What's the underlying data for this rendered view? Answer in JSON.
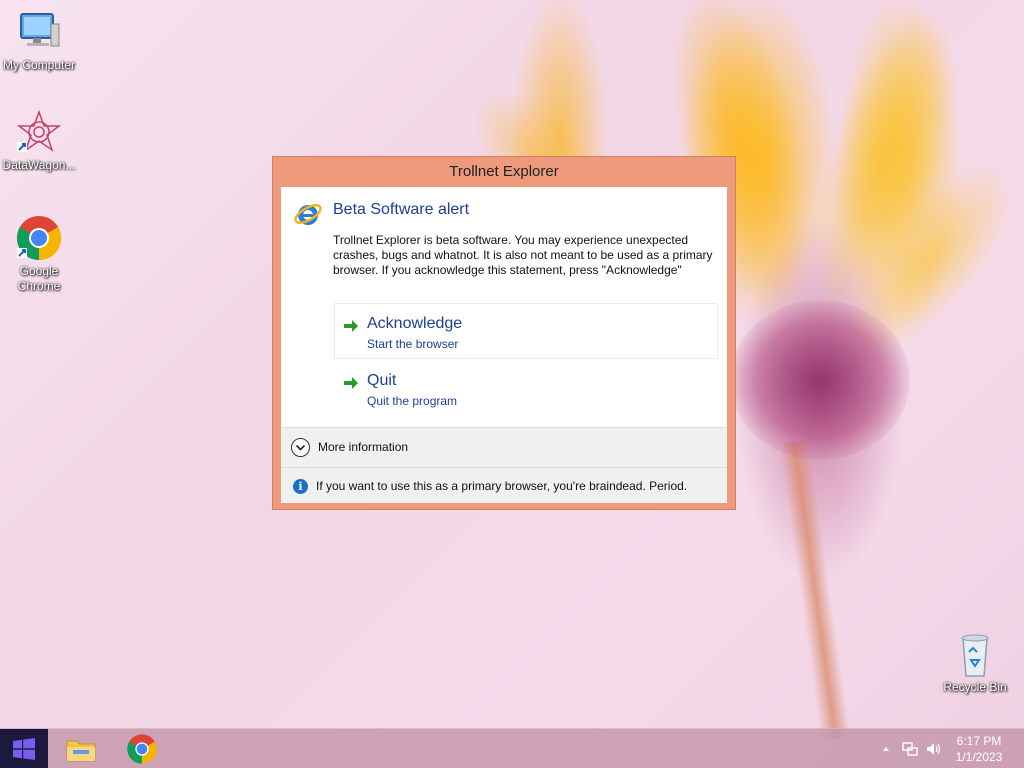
{
  "desktop": {
    "icons": [
      {
        "label": "My Computer",
        "icon": "computer-icon"
      },
      {
        "label": "DataWagon...",
        "icon": "datawagon-icon"
      },
      {
        "label": "Google Chrome",
        "icon": "chrome-icon"
      },
      {
        "label": "Recycle Bin",
        "icon": "recycle-bin-icon"
      }
    ]
  },
  "dialog": {
    "window_title": "Trollnet Explorer",
    "heading": "Beta Software alert",
    "body": "Trollnet Explorer is beta software. You may experience unexpected crashes, bugs and whatnot. It is also not meant to be used as a primary browser. If you acknowledge this statement, press \"Acknowledge\"",
    "options": [
      {
        "label": "Acknowledge",
        "sublabel": "Start the browser"
      },
      {
        "label": "Quit",
        "sublabel": "Quit the program"
      }
    ],
    "more_info": "More information",
    "footer": "If you want to use this as a primary browser, you're braindead. Period."
  },
  "taskbar": {
    "apps": [
      "file-explorer-icon",
      "chrome-icon"
    ],
    "tray_icons": [
      "chevron-up-icon",
      "network-icon",
      "volume-icon"
    ],
    "time": "6:17 PM",
    "date": "1/1/2023"
  },
  "colors": {
    "dialog_frame": "#ee9a7c",
    "link_blue": "#1c3f94",
    "taskbar": "#c496aa",
    "start": "#1b1a3e"
  }
}
